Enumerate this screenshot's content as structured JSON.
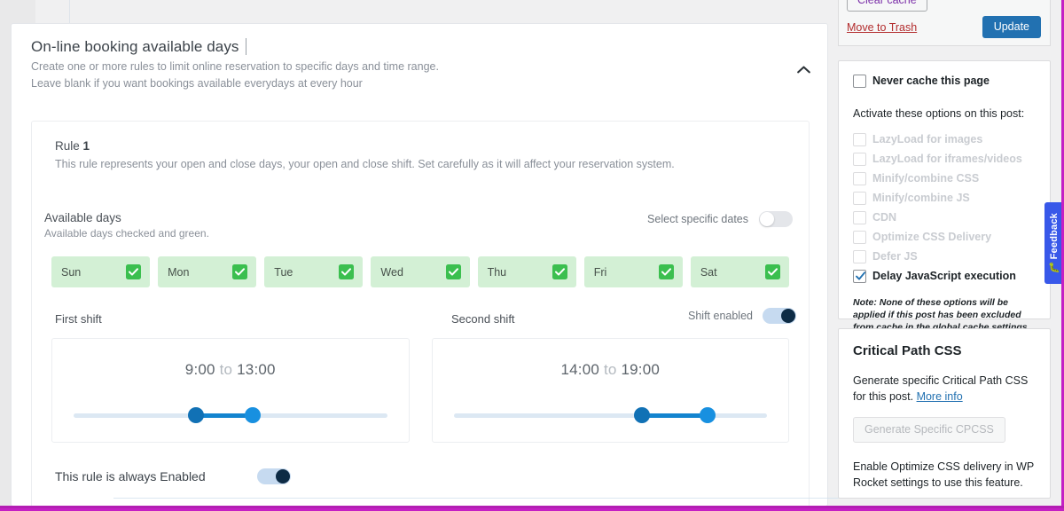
{
  "card": {
    "title": "On-line booking available days",
    "subtitle_line1": "Create one or more rules to limit online reservation to specific days and time range.",
    "subtitle_line2": "Leave blank if you want bookings available everydays at every hour",
    "collapse_icon": "chevron-up-icon"
  },
  "rule": {
    "label_prefix": "Rule ",
    "number": "1",
    "description": "This rule represents your open and close days, your open and close shift. Set carefully as it will affect your reservation system.",
    "available_days_label": "Available days",
    "available_days_sub": "Available days checked and green.",
    "specific_dates_label": "Select specific dates",
    "specific_dates_enabled": false,
    "days": [
      {
        "label": "Sun",
        "checked": true
      },
      {
        "label": "Mon",
        "checked": true
      },
      {
        "label": "Tue",
        "checked": true
      },
      {
        "label": "Wed",
        "checked": true
      },
      {
        "label": "Thu",
        "checked": true
      },
      {
        "label": "Fri",
        "checked": true
      },
      {
        "label": "Sat",
        "checked": true
      }
    ],
    "first_shift": {
      "label": "First shift",
      "start": "9:00",
      "separator": "to",
      "end": "13:00",
      "display": "9:00 to 13:00",
      "slider_lo_pct": 39,
      "slider_hi_pct": 57
    },
    "second_shift": {
      "label": "Second shift",
      "start": "14:00",
      "separator": "to",
      "end": "19:00",
      "display": "14:00 to 19:00",
      "slider_lo_pct": 60,
      "slider_hi_pct": 81,
      "enabled_label": "Shift enabled",
      "enabled": true
    },
    "always_enabled_label": "This rule is always Enabled",
    "always_enabled": true
  },
  "publish": {
    "clear_cache_label": "Clear cache",
    "trash_label": "Move to Trash",
    "update_label": "Update"
  },
  "cache": {
    "never_cache_label": "Never cache this page",
    "never_cache_checked": false,
    "activate_text": "Activate these options on this post:",
    "options": [
      {
        "label": "LazyLoad for images",
        "checked": false,
        "disabled": true
      },
      {
        "label": "LazyLoad for iframes/videos",
        "checked": false,
        "disabled": true
      },
      {
        "label": "Minify/combine CSS",
        "checked": false,
        "disabled": true
      },
      {
        "label": "Minify/combine JS",
        "checked": false,
        "disabled": true
      },
      {
        "label": "CDN",
        "checked": false,
        "disabled": true
      },
      {
        "label": "Optimize CSS Delivery",
        "checked": false,
        "disabled": true
      },
      {
        "label": "Defer JS",
        "checked": false,
        "disabled": true
      },
      {
        "label": "Delay JavaScript execution",
        "checked": true,
        "disabled": false
      }
    ],
    "note": "Note: None of these options will be applied if this post has been excluded from cache in the global cache settings."
  },
  "cpcss": {
    "title": "Critical Path CSS",
    "desc": "Generate specific Critical Path CSS for this post. ",
    "more_info": "More info",
    "button_label": "Generate Specific CPCSS",
    "footer": "Enable Optimize CSS delivery in WP Rocket settings to use this feature."
  },
  "feedback": {
    "label": "Feedback",
    "icon": "bug-icon"
  },
  "colors": {
    "accent_blue": "#2271b1",
    "slider_blue": "#1384cf",
    "day_green_bg": "#d3f0d5",
    "check_green": "#3bbf4f",
    "toggle_on_track": "#c6daf0",
    "toggle_on_knob": "#0d2b45",
    "trash_red": "#b32d2e",
    "clear_cache_purple": "#7b2fa8",
    "admin_bar_magenta": "#c41fc4",
    "feedback_blue": "#3858e9"
  }
}
